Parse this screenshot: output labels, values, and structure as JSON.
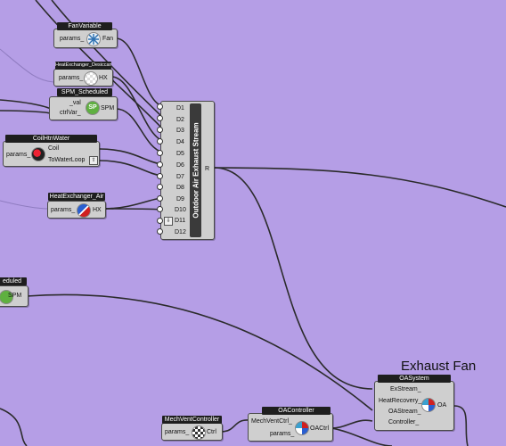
{
  "nodes": {
    "fan_variable": {
      "title": "FanVariable",
      "inputs": [
        "params_"
      ],
      "output": "Fan"
    },
    "hx_desiccant": {
      "title": "HeatExchanger_Desiccant",
      "inputs": [
        "params_"
      ],
      "output": "HX"
    },
    "spm_scheduled": {
      "title": "SPM_Scheduled",
      "inputs": [
        "_val",
        "ctrlVar_"
      ],
      "output": "SPM"
    },
    "coil_htn_water": {
      "title": "CoilHtnWater",
      "inputs": [
        "params_"
      ],
      "outputs": [
        "Coil",
        "ToWaterLoop"
      ]
    },
    "hx_air": {
      "title": "HeatExchanger_Air",
      "inputs": [
        "params_"
      ],
      "output": "HX"
    },
    "spm_partial": {
      "title": "eduled",
      "output": "SPM"
    },
    "outdoor_air_exhaust_stream": {
      "title": "Outdoor Air Exhaust Stream",
      "inputs": [
        "D1",
        "D2",
        "D3",
        "D4",
        "D5",
        "D6",
        "D7",
        "D8",
        "D9",
        "D10",
        "D11",
        "D12"
      ],
      "output": "R"
    },
    "oa_system": {
      "title": "OASystem",
      "inputs": [
        "ExStream_",
        "HeatRecovery_",
        "OAStream_",
        "Controller_"
      ],
      "output": "OA"
    },
    "oa_controller": {
      "title": "OAController",
      "inputs": [
        "MechVentCtrl_",
        "params_"
      ],
      "output": "OACtrl"
    },
    "mech_vent_controller": {
      "title": "MechVentController",
      "inputs": [
        "params_"
      ],
      "output": "Ctrl"
    }
  },
  "group_label": "Exhaust Fan",
  "colors": {
    "canvas": "#b59ee6",
    "node": "#cfcfcf",
    "title": "#1e1e1e",
    "wire": "#2b2b2b"
  }
}
